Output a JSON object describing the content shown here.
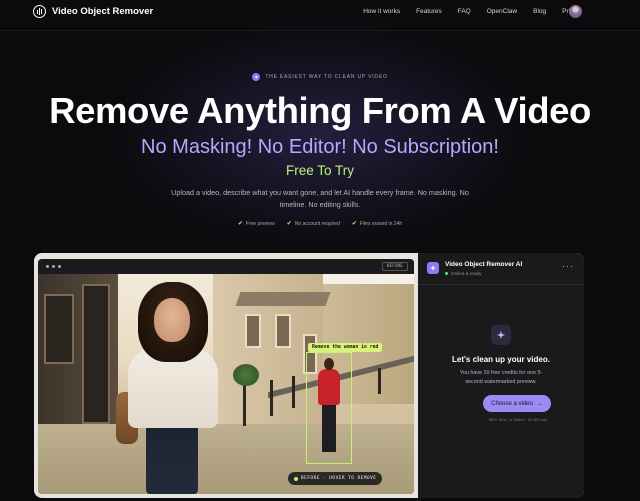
{
  "nav": {
    "brand": "Video Object Remover",
    "links": [
      "How it works",
      "Features",
      "FAQ",
      "OpenClaw",
      "Blog",
      "Pricing"
    ]
  },
  "hero": {
    "eyebrow": "THE EASIEST WAY TO CLEAN UP VIDEO",
    "headline": "Remove Anything From A Video",
    "subhead": "No Masking! No Editor! No Subscription!",
    "free": "Free To Try",
    "description": "Upload a video, describe what you want gone, and let AI handle every frame. No masking. No timeline. No editing skills.",
    "perks": [
      "Free preview",
      "No account required",
      "Files erased in 24h"
    ]
  },
  "demo": {
    "before_tag": "BEFORE",
    "callout": "Remove the woman in red",
    "hover_hint": "BEFORE · HOVER TO REMOVE"
  },
  "chat": {
    "title": "Video Object Remover AI",
    "status": "Online & ready",
    "heading": "Let's clean up your video.",
    "body": "You have 10 free credits for one 5-second watermarked preview.",
    "button": "Choose a video",
    "button_arrow": "→",
    "formats": "MP4, MOV, or WebM · 50 MB max"
  },
  "colors": {
    "accent": "#9b8cf5",
    "subhead": "#b4a8ff",
    "highlight": "#bdf27a",
    "background": "#0b0b0e"
  }
}
